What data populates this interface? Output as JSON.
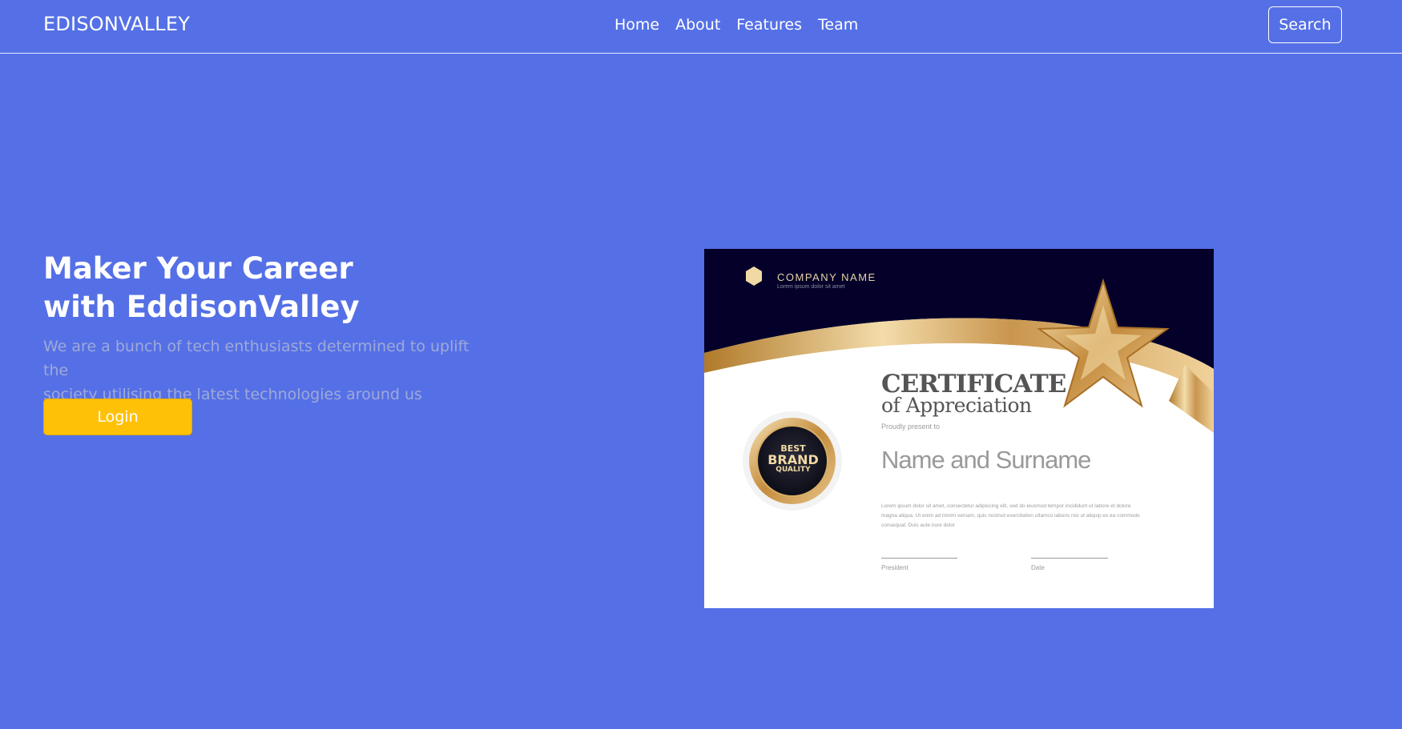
{
  "header": {
    "brand": "EDISONVALLEY",
    "nav": [
      "Home",
      "About",
      "Features",
      "Team"
    ],
    "search_label": "Search"
  },
  "hero": {
    "title_line1": "Maker Your Career",
    "title_line2": "with EddisonValley",
    "subtitle_line1": "We are a bunch of tech enthusiasts determined to uplift the",
    "subtitle_line2": "society utilising the latest technologies around us",
    "login_label": "Login"
  },
  "certificate": {
    "company_name": "COMPANY NAME",
    "company_sub": "Lorem ipsum dolor sit amet",
    "title": "CERTIFICATE",
    "subtitle": "of Appreciation",
    "present": "Proudly present to",
    "name": "Name and Surname",
    "body": "Lorem ipsum dolor sit amet, consectetur adipiscing elit, sed do eiusmod tempor incididunt ut labore et dolore magna aliqua. Ut enim ad minim veniam, quis nostrud exercitation ullamco laboris nisi ut aliquip ex ea commodo consequat. Duis aute irure dolor",
    "sign_left": "President",
    "sign_right": "Date",
    "badge_top": "BEST",
    "badge_mid": "BRAND",
    "badge_bottom": "QUALITY"
  },
  "colors": {
    "background": "#5570e6",
    "accent": "#ffc107",
    "muted_text": "#9fa9d8"
  }
}
